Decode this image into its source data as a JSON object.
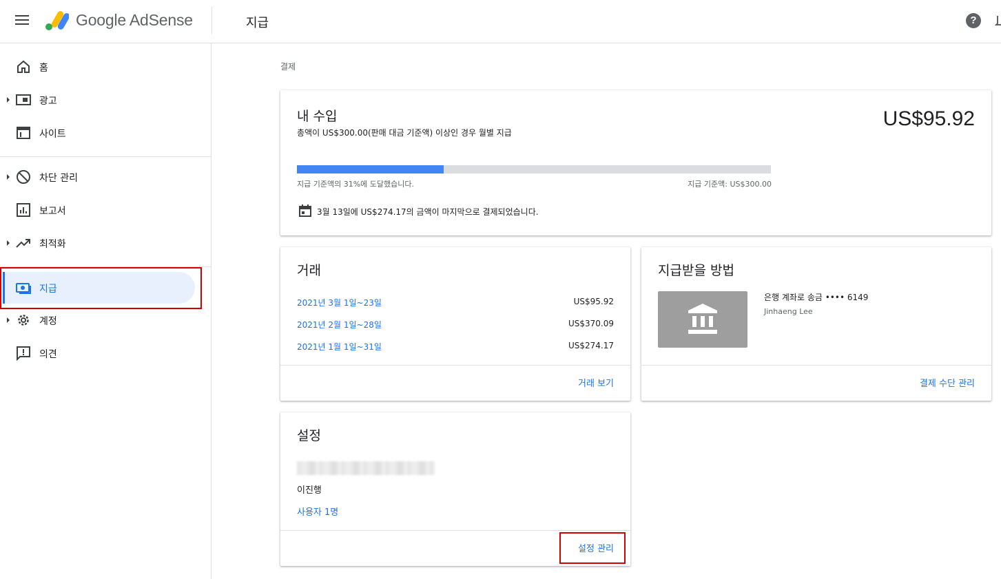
{
  "header": {
    "brand": "Google AdSense",
    "page_title": "지급",
    "help_symbol": "?"
  },
  "sidebar": {
    "items": [
      {
        "label": "홈",
        "icon": "home-icon",
        "has_caret": false
      },
      {
        "label": "광고",
        "icon": "ads-icon",
        "has_caret": true
      },
      {
        "label": "사이트",
        "icon": "sites-icon",
        "has_caret": false
      },
      {
        "label": "차단 관리",
        "icon": "block-icon",
        "has_caret": true
      },
      {
        "label": "보고서",
        "icon": "reports-icon",
        "has_caret": false
      },
      {
        "label": "최적화",
        "icon": "optimization-icon",
        "has_caret": true
      },
      {
        "label": "지급",
        "icon": "payments-icon",
        "has_caret": false,
        "active": true
      },
      {
        "label": "계정",
        "icon": "gear-icon",
        "has_caret": true
      },
      {
        "label": "의견",
        "icon": "feedback-icon",
        "has_caret": false
      }
    ]
  },
  "breadcrumb": "결제",
  "earnings": {
    "title": "내 수입",
    "subtitle": "총액이 US$300.00(판매 대금 기준액) 이상인 경우 월별 지급",
    "amount": "US$95.92",
    "progress_percent": 31,
    "progress_left_label": "지급 기준액의 31%에 도달했습니다.",
    "progress_right_label": "지급 기준액: US$300.00",
    "last_payment": "3월 13일에 US$274.17의 금액이 마지막으로 결제되었습니다."
  },
  "transactions": {
    "title": "거래",
    "rows": [
      {
        "period": "2021년 3월 1일~23일",
        "amount": "US$95.92"
      },
      {
        "period": "2021년 2월 1일~28일",
        "amount": "US$370.09"
      },
      {
        "period": "2021년 1월 1일~31일",
        "amount": "US$274.17"
      }
    ],
    "link": "거래 보기"
  },
  "payment_method": {
    "title": "지급받을 방법",
    "bank_line": "은행 계좌로 송금 •••• 6149",
    "holder": "Jinhaeng Lee",
    "link": "결제 수단 관리"
  },
  "settings": {
    "title": "설정",
    "name": "이진행",
    "users_link": "사용자 1명",
    "link": "설정 관리"
  },
  "colors": {
    "accent": "#1a73e8",
    "progress_fill": "#4285f4",
    "highlight_box": "#d00000",
    "active_nav_bg": "#e8f0fe"
  }
}
